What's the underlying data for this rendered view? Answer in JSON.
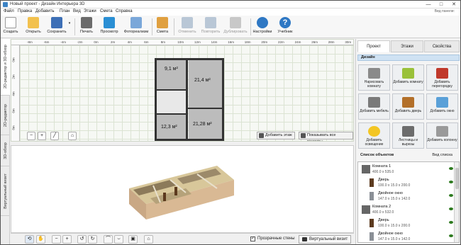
{
  "window": {
    "title": "Новый проект - Дизайн Интерьера 3D",
    "minimize": "—",
    "maximize": "□",
    "close": "✕"
  },
  "menu": {
    "items": [
      "Файл",
      "Правка",
      "Добавить",
      "План",
      "Вид",
      "Этажи",
      "Смета",
      "Справка"
    ],
    "view_panel": "Вид панели:"
  },
  "toolbar": {
    "buttons": [
      {
        "label": "Создать",
        "icon": "new-file-icon",
        "color": "#ffffff"
      },
      {
        "label": "Открыть",
        "icon": "folder-icon",
        "color": "#f2c14e"
      },
      {
        "label": "Сохранить",
        "icon": "save-icon",
        "color": "#3d6fb6"
      },
      {
        "label": "Печать",
        "icon": "printer-icon",
        "color": "#6b6b6b"
      },
      {
        "label": "Просмотр",
        "icon": "monitor-icon",
        "color": "#2a8fd4"
      },
      {
        "label": "Фотореализм",
        "icon": "photo-icon",
        "color": "#7aa7d9"
      },
      {
        "label": "Смета",
        "icon": "estimate-icon",
        "color": "#e0a040"
      },
      {
        "label": "Отменить",
        "icon": "undo-icon",
        "color": "#b9c7d6"
      },
      {
        "label": "Повторить",
        "icon": "redo-icon",
        "color": "#b9c7d6"
      },
      {
        "label": "Дублировать",
        "icon": "duplicate-icon",
        "color": "#c8c8c8"
      },
      {
        "label": "Настройки",
        "icon": "gear-icon",
        "color": "#2f78c4"
      },
      {
        "label": "Учебник",
        "icon": "help-icon",
        "color": "#2f78c4"
      }
    ]
  },
  "left_tabs": [
    "2D-редактор и 3D-обзор",
    "2D-редактор",
    "3D-обзор",
    "Виртуальный визит"
  ],
  "plan": {
    "ruler_top": [
      "-8m",
      "-6m",
      "-4m",
      "-2m",
      "0m",
      "2m",
      "4m",
      "6m",
      "8m",
      "10m",
      "12m",
      "14m",
      "16m",
      "18m",
      "20m",
      "22m",
      "24m",
      "26m",
      "28m",
      "30m",
      "32m",
      "34m"
    ],
    "ruler_left": [
      "0m",
      "2m",
      "4m",
      "6m",
      "8m"
    ],
    "rooms": [
      {
        "label": "9,1 м²"
      },
      {
        "label": "21,4 м²"
      },
      {
        "label": "12,3 м²"
      },
      {
        "label": "21,28 м²"
      }
    ],
    "add_floor": "Добавить этаж",
    "show_dims": "Показывать все размеры"
  },
  "view3d": {
    "transparent_walls": "Прозрачные стены",
    "virtual_visit": "Виртуальный визит",
    "transparent_checked": true
  },
  "right_panel": {
    "tabs": [
      "Проект",
      "Этажи",
      "Свойства"
    ],
    "active_tab": 0,
    "design_header": "Дизайн",
    "tiles": [
      {
        "label": "Нарисовать комнату",
        "icon": "draw-room-icon",
        "color": "#8a8a8a"
      },
      {
        "label": "Добавить комнату",
        "icon": "add-room-icon",
        "color": "#9ac13a"
      },
      {
        "label": "Добавить перегородку",
        "icon": "add-wall-icon",
        "color": "#c0392b"
      },
      {
        "label": "Добавить мебель",
        "icon": "furniture-icon",
        "color": "#7a7a7a"
      },
      {
        "label": "Добавить дверь",
        "icon": "door-icon",
        "color": "#b3702a"
      },
      {
        "label": "Добавить окно",
        "icon": "window-icon",
        "color": "#5aa0d8"
      },
      {
        "label": "Добавить освещение",
        "icon": "lamp-icon",
        "color": "#f3c623"
      },
      {
        "label": "Лестницы и вырезы",
        "icon": "stairs-icon",
        "color": "#6c6c6c"
      },
      {
        "label": "Добавить колонну",
        "icon": "column-icon",
        "color": "#9a9a9a"
      }
    ],
    "objects_header": "Список объектов",
    "list_view": "Вид списка",
    "objects": [
      {
        "name": "Комната 1",
        "size": "400.0 x 535.0",
        "type": "room"
      },
      {
        "name": "Дверь",
        "size": "100.0 x 15.0 x 200.0",
        "type": "door"
      },
      {
        "name": "Двойное окно",
        "size": "147.0 x 15.0 x 142.0",
        "type": "window"
      },
      {
        "name": "Комната 2",
        "size": "400.0 x 532.0",
        "type": "room"
      },
      {
        "name": "Дверь",
        "size": "100.0 x 15.0 x 200.0",
        "type": "door"
      },
      {
        "name": "Двойное окно",
        "size": "147.0 x 15.0 x 142.0",
        "type": "window"
      }
    ]
  }
}
